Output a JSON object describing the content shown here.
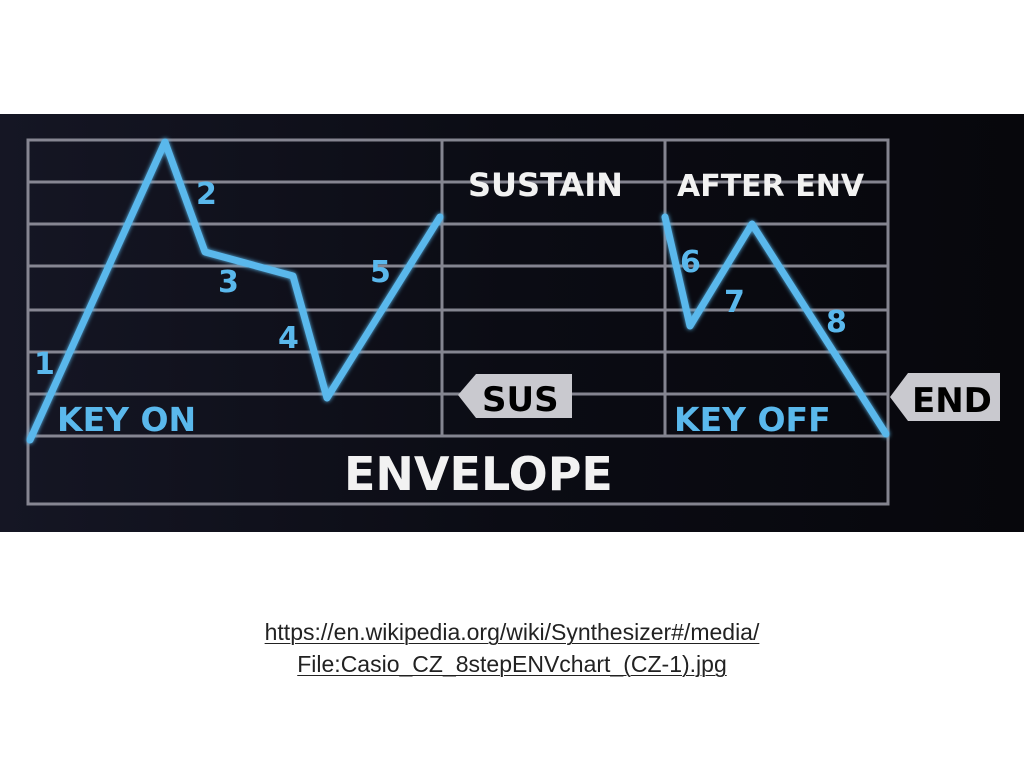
{
  "diagram": {
    "step_labels": [
      "1",
      "2",
      "3",
      "4",
      "5",
      "6",
      "7",
      "8"
    ],
    "sustain_label": "SUSTAIN",
    "after_env_label": "AFTER ENV",
    "key_on_label": "KEY ON",
    "key_off_label": "KEY OFF",
    "sus_marker_label": "SUS",
    "end_marker_label": "END",
    "envelope_label": "ENVELOPE",
    "colors": {
      "background": "#0b0c14",
      "grid": "#9a9aa6",
      "envelope_line": "#5ab8ec",
      "label_white": "#f2f2f2",
      "marker_bg": "#c9c9cf",
      "marker_text": "#000000"
    }
  },
  "caption": {
    "line1": "https://en.wikipedia.org/wiki/Synthesizer#/media/",
    "line2": "File:Casio_CZ_8stepENVchart_(CZ-1).jpg"
  }
}
